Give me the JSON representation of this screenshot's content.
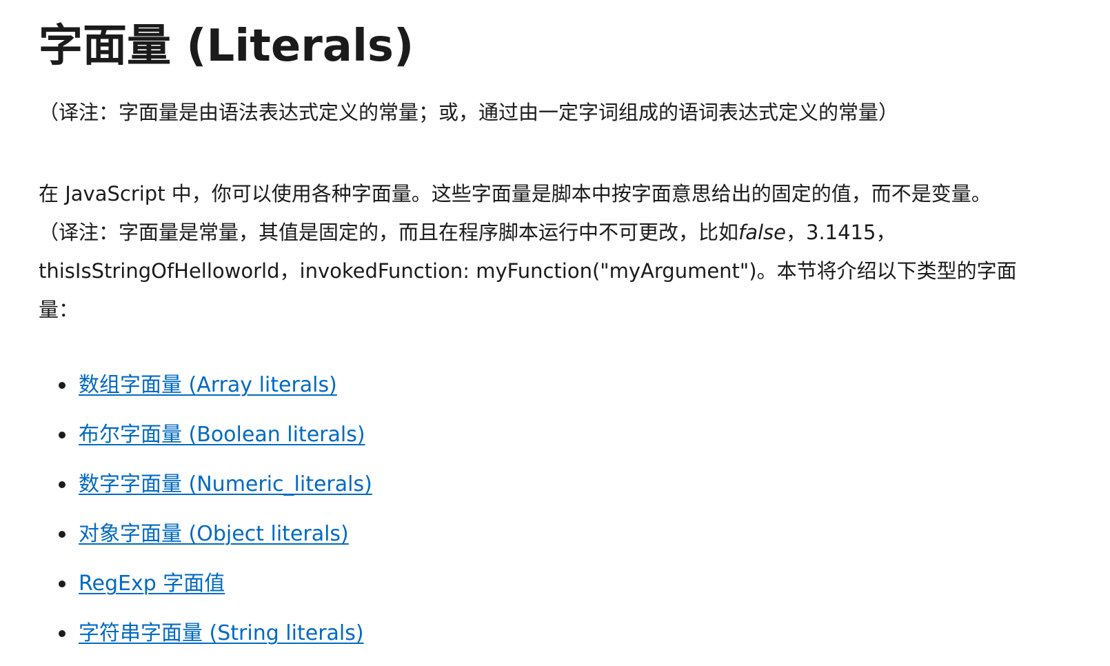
{
  "page": {
    "title": "字面量 (Literals)",
    "translator_note": "（译注：字面量是由语法表达式定义的常量；或，通过由一定字词组成的语词表达式定义的常量）",
    "intro": {
      "line1": "在 JavaScript 中，你可以使用各种字面量。这些字面量是脚本中按字面意思给出的固定的值，而不是变量。",
      "line2_before": "（译注：字面量是常量，其值是固定的，而且在程序脚本运行中不可更改，比如",
      "line2_em": "false",
      "line2_after": "，3.1415，",
      "line3": "thisIsStringOfHelloworld，invokedFunction: myFunction(\"myArgument\")。本节将介绍以下类型的字面",
      "line4": "量："
    },
    "topics": [
      {
        "label": "数组字面量 (Array literals)"
      },
      {
        "label": "布尔字面量 (Boolean literals)"
      },
      {
        "label": "数字字面量 (Numeric_literals)"
      },
      {
        "label": "对象字面量 (Object literals)"
      },
      {
        "label": "RegExp 字面值"
      },
      {
        "label": "字符串字面量 (String literals)"
      }
    ]
  },
  "colors": {
    "text": "#1b1b1b",
    "link": "#0069c2",
    "background": "#ffffff"
  }
}
